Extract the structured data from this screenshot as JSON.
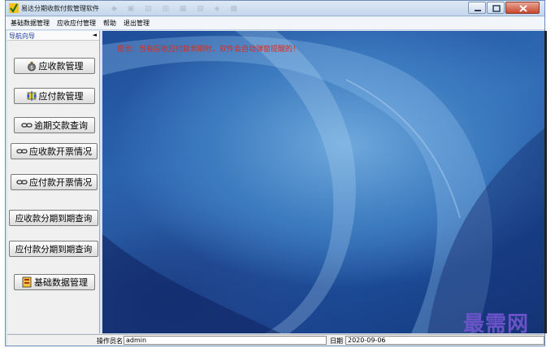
{
  "window": {
    "title": "易达分期收款付款管理软件"
  },
  "titlebar": {
    "faded_toolbar_glyphs": "◆ ▣ ▤ ▥ ▦ ▧ ◈ ▩"
  },
  "menu": [
    "基础数据管理",
    "应收应付管理",
    "帮助",
    "退出管理"
  ],
  "nav": {
    "header": "导航向导",
    "collapse_glyph": "◄",
    "buttons": [
      {
        "label": "应收款管理",
        "icon": "money-bag-icon"
      },
      {
        "label": "应付款管理",
        "icon": "payment-icon"
      },
      {
        "label": "逾期交款查询",
        "icon": "link-icon"
      },
      {
        "label": "应收款开票情况",
        "icon": "link-icon"
      },
      {
        "label": "应付款开票情况",
        "icon": "link-icon"
      },
      {
        "label": "应收款分期到期查询",
        "icon": ""
      },
      {
        "label": "应付款分期到期查询",
        "icon": ""
      },
      {
        "label": "基础数据管理",
        "icon": "data-icon"
      }
    ]
  },
  "main": {
    "reminder": "提示：当有应收应付款到期时，软件会自动弹窗提醒的！"
  },
  "status": {
    "operator_label": "操作员名",
    "operator_value": "admin",
    "date_label": "日期",
    "date_value": "2020-09-06"
  },
  "watermark": "最需网",
  "colors": {
    "reminder": "#e02a1a",
    "nav_header": "#1c3c9a",
    "watermark": "#6a52c8"
  }
}
